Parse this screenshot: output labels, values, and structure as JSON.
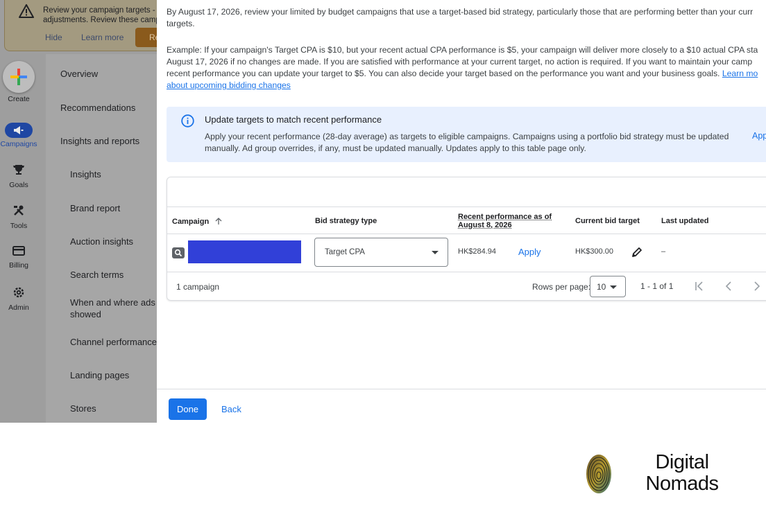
{
  "alert": {
    "line1": "Review your campaign targets - S",
    "line2": "adjustments. Review these camp",
    "hide_label": "Hide",
    "learn_more_label": "Learn more",
    "action_label": "Re"
  },
  "rail": {
    "create": "Create",
    "campaigns": "Campaigns",
    "goals": "Goals",
    "tools": "Tools",
    "billing": "Billing",
    "admin": "Admin"
  },
  "nav": {
    "overview": "Overview",
    "recommendations": "Recommendations",
    "insights_and_reports": "Insights and reports",
    "insights": "Insights",
    "brand_report": "Brand report",
    "auction_insights": "Auction insights",
    "search_terms": "Search terms",
    "when_where_line1": "When and where ads",
    "when_where_line2": "showed",
    "channel_performance": "Channel performance",
    "landing_pages": "Landing pages",
    "stores": "Stores"
  },
  "dialog": {
    "intro_line1": "By August 17, 2026, review your limited by budget campaigns that use a target-based bid strategy, particularly those that are performing better than your curr",
    "intro_line2": "targets.",
    "example_line1": "Example: If your campaign's Target CPA is $10, but your recent actual CPA performance is $5, your campaign will deliver more closely to a $10 actual CPA sta",
    "example_line2": "August 17, 2026 if no changes are made. If you are satisfied with performance at your current target, no action is required. If you want to maintain your camp",
    "example_line3": "recent performance you can update your target to $5. You can also decide your target based on the performance you want and your business goals. ",
    "example_link_part1": "Learn mo",
    "example_link_part2": "about upcoming bidding changes",
    "info_title": "Update targets to match recent performance",
    "info_body_line1": "Apply your recent performance (28-day average) as targets to eligible campaigns. Campaigns using a portfolio bid strategy must be updated",
    "info_body_line2": "manually. Ad group overrides, if any, must be updated manually. Updates apply to this table page only.",
    "info_apply": "App",
    "table": {
      "headers": {
        "campaign": "Campaign",
        "bid_strategy_type": "Bid strategy type",
        "recent_perf_line1": "Recent performance as of",
        "recent_perf_line2": "August 8, 2026",
        "current_bid_target": "Current bid target",
        "last_updated": "Last updated"
      },
      "row": {
        "bid_strategy": "Target CPA",
        "recent_performance": "HK$284.94",
        "apply_label": "Apply",
        "current_target": "HK$300.00",
        "last_updated": "–"
      },
      "footer": {
        "count": "1 campaign",
        "rows_per_page_label": "Rows per page:",
        "rows_per_page_value": "10",
        "range": "1 - 1 of 1"
      }
    },
    "done_label": "Done",
    "back_label": "Back"
  },
  "watermark": {
    "line1": "Digital",
    "line2": "Nomads"
  },
  "colors": {
    "accent": "#1a73e8",
    "info_bg": "#e8f0fe",
    "redaction": "#3140d8"
  }
}
